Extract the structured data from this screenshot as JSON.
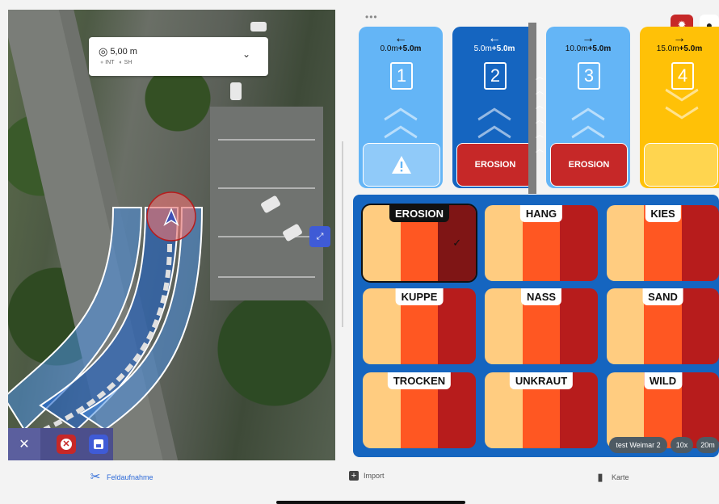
{
  "map": {
    "distance": "5,00 m",
    "status_int": "INT",
    "status_sh": "SH"
  },
  "segments": [
    {
      "range_start": "0.0m",
      "range_inc": "+5.0m",
      "number": "1",
      "arrow": "←",
      "footer": "",
      "footer_icon": "warning-icon"
    },
    {
      "range_start": "5.0m",
      "range_inc": "+5.0m",
      "number": "2",
      "arrow": "←",
      "footer": "EROSION"
    },
    {
      "range_start": "10.0m",
      "range_inc": "+5.0m",
      "number": "3",
      "arrow": "→",
      "footer": "EROSION"
    },
    {
      "range_start": "15.0m",
      "range_inc": "+5.0m",
      "number": "4",
      "arrow": "→",
      "footer": ""
    }
  ],
  "tiles": [
    "EROSION",
    "HANG",
    "KIES",
    "KUPPE",
    "NASS",
    "SAND",
    "TROCKEN",
    "UNKRAUT",
    "WILD"
  ],
  "chips": {
    "name": "test Weimar 2",
    "zoom": "10x",
    "dist": "20m"
  },
  "nav": {
    "feld": "Feldaufnahme",
    "import": "Import",
    "karte": "Karte"
  },
  "colors": {
    "seg_light": "#64b5f6",
    "seg_dark": "#1565c0",
    "seg_yellow": "#ffc107",
    "erosion_red": "#c62828"
  }
}
